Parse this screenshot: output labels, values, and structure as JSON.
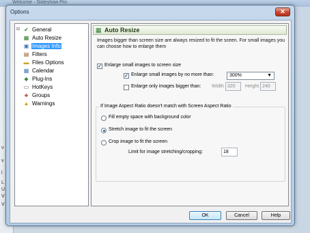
{
  "background": {
    "title": "Welcome - Slideshow Pro",
    "marks": [
      "v",
      "v",
      "l",
      "L",
      "U",
      "V",
      "V"
    ]
  },
  "dialog": {
    "title": "Options",
    "close_symbol": "✕"
  },
  "tree": {
    "items": [
      {
        "label": "General",
        "icon": "checkmark-icon"
      },
      {
        "label": "Auto Resize",
        "icon": "resize-grid-icon"
      },
      {
        "label": "Images Info",
        "icon": "image-info-icon",
        "selected": true
      },
      {
        "label": "Filters",
        "icon": "filter-icon"
      },
      {
        "label": "Files Options",
        "icon": "folder-icon"
      },
      {
        "label": "Calendar",
        "icon": "calendar-icon"
      },
      {
        "label": "Plug-Ins",
        "icon": "plug-icon"
      },
      {
        "label": "HotKeys",
        "icon": "keyboard-icon"
      },
      {
        "label": "Groups",
        "icon": "groups-icon"
      },
      {
        "label": "Warnings",
        "icon": "warning-icon"
      }
    ]
  },
  "pane": {
    "title": "Auto Resize",
    "description": "Images bigger than screen size are always resized to fit the sceen. For small images you can choose how to enlarge them",
    "enlarge_small": {
      "label": "Enlarge small images to screen size",
      "checked": true
    },
    "enlarge_by": {
      "label": "Enlarge small images by no more than:",
      "checked": true
    },
    "zoom_select": {
      "value": "300%"
    },
    "enlarge_only": {
      "label": "Enlarge only images bigger than:",
      "checked": false
    },
    "width": {
      "label": "Width",
      "value": "320"
    },
    "height": {
      "label": "Height",
      "value": "240"
    },
    "aspect_group": {
      "title": "If Image Aspect Ratio doesn't match with Screen Aspect Ratio"
    },
    "option_fill": {
      "label": "Fill empty space with background color",
      "selected": false
    },
    "option_stretch": {
      "label": "Stretch image to fit the screen",
      "selected": true
    },
    "option_crop": {
      "label": "Crop image to fit the screen",
      "selected": false
    },
    "limit": {
      "label": "Limit for image stretching/cropping:",
      "value": "18"
    }
  },
  "buttons": {
    "ok": "OK",
    "cancel": "Cancel",
    "help": "Help"
  },
  "colors": {
    "selection": "#3399ff",
    "header_green": "#2f7a2f",
    "close_red": "#c7442c"
  }
}
